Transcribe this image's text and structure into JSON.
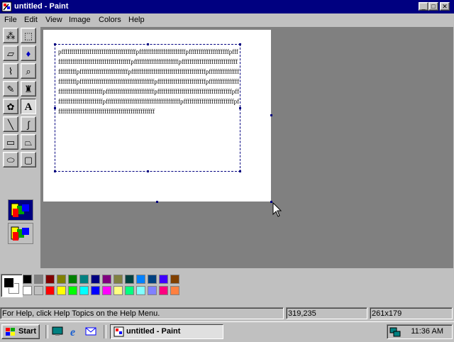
{
  "window": {
    "title": "untitled - Paint",
    "controls": {
      "minimize": "_",
      "maximize": "□",
      "close": "✕"
    }
  },
  "menu": [
    "File",
    "Edit",
    "View",
    "Image",
    "Colors",
    "Help"
  ],
  "tools": [
    {
      "name": "free-form-select",
      "icon": "star-select-icon",
      "glyph": "⁂"
    },
    {
      "name": "select",
      "icon": "rect-select-icon",
      "glyph": "⬚"
    },
    {
      "name": "eraser",
      "icon": "eraser-icon",
      "glyph": "▱"
    },
    {
      "name": "fill",
      "icon": "fill-bucket-icon",
      "glyph": "♦"
    },
    {
      "name": "pick-color",
      "icon": "eyedropper-icon",
      "glyph": "⌇"
    },
    {
      "name": "magnifier",
      "icon": "magnifier-icon",
      "glyph": "⌕"
    },
    {
      "name": "pencil",
      "icon": "pencil-icon",
      "glyph": "✎"
    },
    {
      "name": "brush",
      "icon": "brush-icon",
      "glyph": "♜"
    },
    {
      "name": "airbrush",
      "icon": "airbrush-icon",
      "glyph": "✿"
    },
    {
      "name": "text",
      "icon": "text-tool-icon",
      "glyph": "A"
    },
    {
      "name": "line",
      "icon": "line-icon",
      "glyph": "╲"
    },
    {
      "name": "curve",
      "icon": "curve-icon",
      "glyph": "∫"
    },
    {
      "name": "rectangle",
      "icon": "rectangle-icon",
      "glyph": "▭"
    },
    {
      "name": "polygon",
      "icon": "polygon-icon",
      "glyph": "⏢"
    },
    {
      "name": "ellipse",
      "icon": "ellipse-icon",
      "glyph": "⬭"
    },
    {
      "name": "rounded-rectangle",
      "icon": "rounded-rect-icon",
      "glyph": "▢"
    }
  ],
  "selected_tool": "text",
  "canvas": {
    "text": "pfffffffffffffffffffffffffffffffffffffpfffffffffffffffffffffffpffffffffffffffffffffpfffffffffffffffffffffffffffffffffffffffpffffffffffffffffffffffpfffffffffffffffffffffffffffffffffffffpffffffffffffffffffffffffpfffffffffffffffffffffffffffffffffffffpffffffffffffffffffffffffpfffffffffffffffffffffffffffffffffffffpffffffffffffffffffffffffpfffffffffffffffffffffffffffffffffffffpffffffffffffffffffffffffpfffffffffffffffffffffffffffffffffffffpffffffffffffffffffffffffpfffffffffffffffffffffffffffffffffffffpfffffffffffffffffffffffffpfffffffffffffffffffffffffffffffffffffffffffffffff"
  },
  "palette": {
    "foreground": "#000000",
    "background": "#ffffff",
    "row1": [
      "#000000",
      "#808080",
      "#800000",
      "#808000",
      "#008000",
      "#008080",
      "#000080",
      "#800080",
      "#808040",
      "#004040",
      "#0080ff",
      "#004080",
      "#4000ff",
      "#804000"
    ],
    "row2": [
      "#ffffff",
      "#c0c0c0",
      "#ff0000",
      "#ffff00",
      "#00ff00",
      "#00ffff",
      "#0000ff",
      "#ff00ff",
      "#ffff80",
      "#00ff80",
      "#80ffff",
      "#8080ff",
      "#ff0080",
      "#ff8040"
    ]
  },
  "status": {
    "help": "For Help, click Help Topics on the Help Menu.",
    "coords": "319,235",
    "size": "261x179"
  },
  "taskbar": {
    "start": "Start",
    "task": "untitled - Paint",
    "clock": "11:36 AM"
  }
}
